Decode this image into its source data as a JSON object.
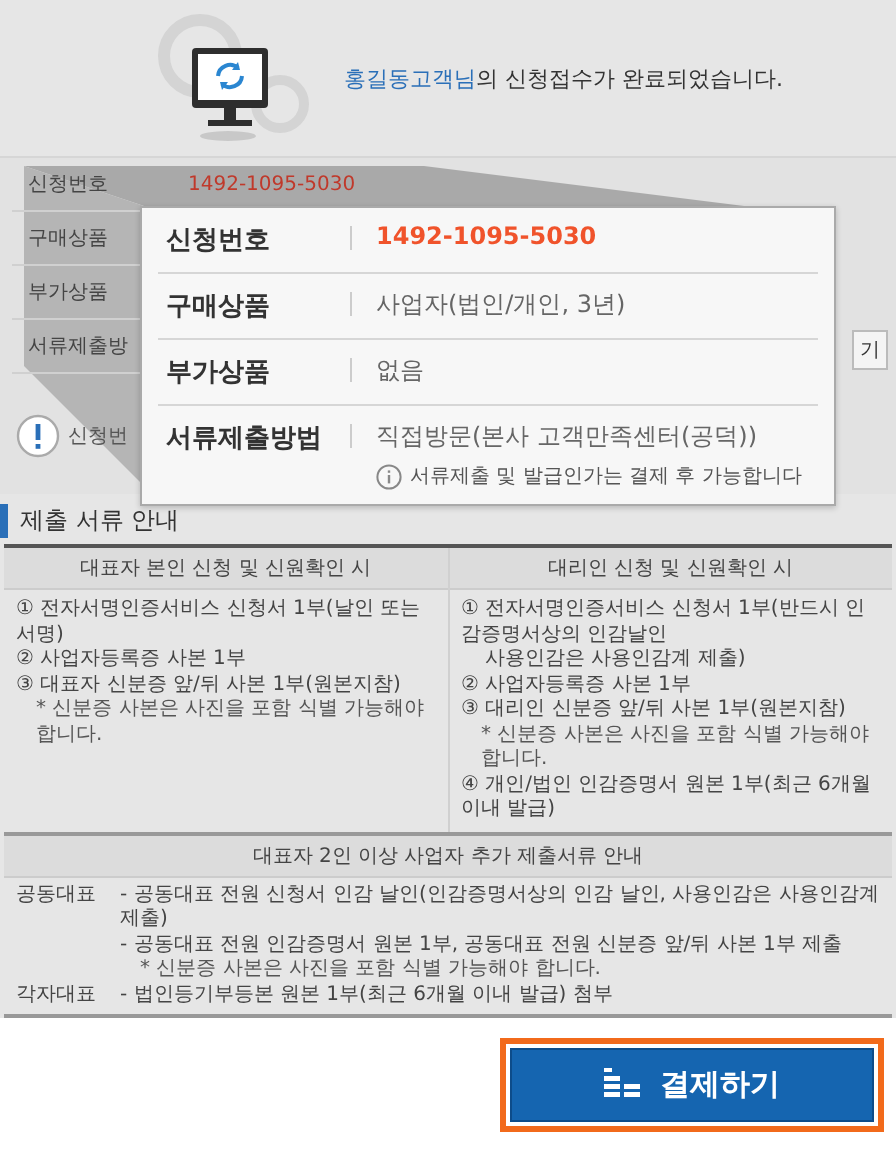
{
  "header": {
    "name": "홍길동고객님",
    "message": "의 신청접수가 완료되었습니다."
  },
  "summary": {
    "rows": [
      {
        "label": "신청번호",
        "value": "1492-1095-5030"
      },
      {
        "label": "구매상품"
      },
      {
        "label": "부가상품"
      },
      {
        "label": "서류제출방"
      }
    ],
    "side_button": "기",
    "notice": "신청번"
  },
  "magnified": {
    "rows": [
      {
        "label": "신청번호",
        "value": "1492-1095-5030",
        "kind": "highlight"
      },
      {
        "label": "구매상품",
        "value": "사업자(법인/개인, 3년)",
        "kind": "plain"
      },
      {
        "label": "부가상품",
        "value": "없음",
        "kind": "plain"
      },
      {
        "label": "서류제출방법",
        "value": "직접방문(본사 고객만족센터(공덕))",
        "kind": "plain",
        "note": "서류제출 및 발급인가는 결제 후 가능합니다"
      }
    ]
  },
  "documents": {
    "title": "제출 서류 안내",
    "columns": [
      {
        "heading": "대표자 본인 신청 및 신원확인 시",
        "items": [
          {
            "text": "① 전자서명인증서비스 신청서 1부(날인 또는 서명)",
            "kind": "item"
          },
          {
            "text": "② 사업자등록증 사본 1부",
            "kind": "item"
          },
          {
            "text": "③ 대표자 신분증 앞/뒤 사본 1부(원본지참)",
            "kind": "item"
          },
          {
            "text": "* 신분증 사본은 사진을 포함 식별 가능해야 합니다.",
            "kind": "note"
          }
        ]
      },
      {
        "heading": "대리인 신청 및 신원확인 시",
        "items": [
          {
            "text": "① 전자서명인증서비스 신청서 1부(반드시 인감증명서상의 인감날인",
            "kind": "item"
          },
          {
            "text": "사용인감은 사용인감계 제출)",
            "kind": "cont"
          },
          {
            "text": "② 사업자등록증 사본 1부",
            "kind": "item"
          },
          {
            "text": "③ 대리인 신분증 앞/뒤 사본 1부(원본지참)",
            "kind": "item"
          },
          {
            "text": "* 신분증 사본은 사진을 포함 식별 가능해야 합니다.",
            "kind": "note"
          },
          {
            "text": "④ 개인/법인 인감증명서 원본 1부(최근 6개월 이내 발급)",
            "kind": "item"
          }
        ]
      }
    ],
    "extra": {
      "heading": "대표자 2인 이상 사업자 추가 제출서류 안내",
      "rows": [
        {
          "label": "공동대표",
          "lines": [
            {
              "text": "- 공동대표 전원 신청서 인감 날인(인감증명서상의 인감 날인, 사용인감은 사용인감계 제출)",
              "kind": "item"
            },
            {
              "text": "- 공동대표 전원 인감증명서 원본 1부, 공동대표 전원 신분증 앞/뒤 사본 1부 제출",
              "kind": "item"
            },
            {
              "text": "* 신분증 사본은 사진을 포함 식별 가능해야 합니다.",
              "kind": "note"
            }
          ]
        },
        {
          "label": "각자대표",
          "lines": [
            {
              "text": "- 법인등기부등본 원본 1부(최근 6개월 이내 발급) 첨부",
              "kind": "item"
            }
          ]
        }
      ]
    }
  },
  "pay_button": "결제하기"
}
